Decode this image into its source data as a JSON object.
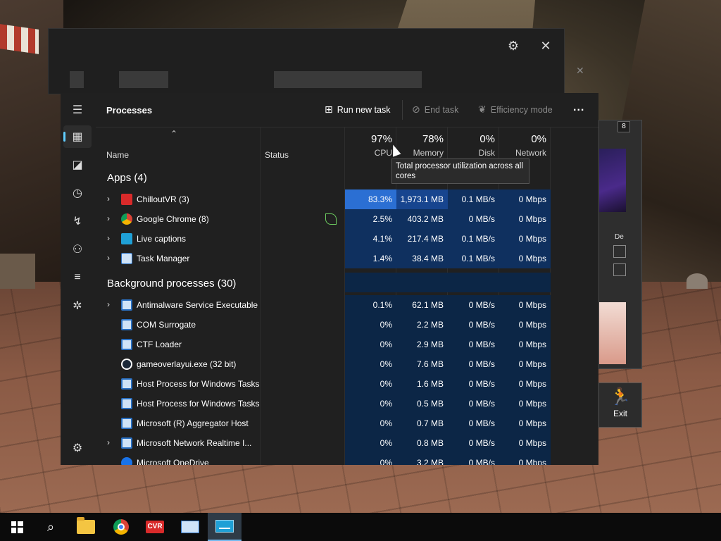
{
  "scene": {
    "exit_label": "Exit",
    "side_badge": "8",
    "side_text": "De"
  },
  "task_manager": {
    "page_title": "Processes",
    "commands": {
      "run_new_task": "Run new task",
      "end_task": "End task",
      "efficiency_mode": "Efficiency mode",
      "more": "..."
    },
    "columns": {
      "name": "Name",
      "status": "Status",
      "cpu": {
        "pct": "97%",
        "label": "CPU"
      },
      "memory": {
        "pct": "78%",
        "label": "Memory"
      },
      "disk": {
        "pct": "0%",
        "label": "Disk"
      },
      "network": {
        "pct": "0%",
        "label": "Network"
      }
    },
    "tooltip": "Total processor utilization across all cores",
    "apps_heading": "Apps (4)",
    "apps": [
      {
        "name": "ChilloutVR (3)",
        "cpu": "83.3%",
        "memory": "1,973.1 MB",
        "disk": "0.1 MB/s",
        "network": "0 Mbps",
        "icon": "chilloutvr-icon"
      },
      {
        "name": "Google Chrome (8)",
        "cpu": "2.5%",
        "memory": "403.2 MB",
        "disk": "0 MB/s",
        "network": "0 Mbps",
        "icon": "chrome-icon"
      },
      {
        "name": "Live captions",
        "cpu": "4.1%",
        "memory": "217.4 MB",
        "disk": "0.1 MB/s",
        "network": "0 Mbps",
        "icon": "live-captions-icon"
      },
      {
        "name": "Task Manager",
        "cpu": "1.4%",
        "memory": "38.4 MB",
        "disk": "0.1 MB/s",
        "network": "0 Mbps",
        "icon": "task-manager-icon"
      }
    ],
    "bg_heading": "Background processes (30)",
    "background": [
      {
        "name": "Antimalware Service Executable",
        "cpu": "0.1%",
        "memory": "62.1 MB",
        "disk": "0 MB/s",
        "network": "0 Mbps"
      },
      {
        "name": "COM Surrogate",
        "cpu": "0%",
        "memory": "2.2 MB",
        "disk": "0 MB/s",
        "network": "0 Mbps"
      },
      {
        "name": "CTF Loader",
        "cpu": "0%",
        "memory": "2.9 MB",
        "disk": "0 MB/s",
        "network": "0 Mbps"
      },
      {
        "name": "gameoverlayui.exe (32 bit)",
        "cpu": "0%",
        "memory": "7.6 MB",
        "disk": "0 MB/s",
        "network": "0 Mbps"
      },
      {
        "name": "Host Process for Windows Tasks",
        "cpu": "0%",
        "memory": "1.6 MB",
        "disk": "0 MB/s",
        "network": "0 Mbps"
      },
      {
        "name": "Host Process for Windows Tasks",
        "cpu": "0%",
        "memory": "0.5 MB",
        "disk": "0 MB/s",
        "network": "0 Mbps"
      },
      {
        "name": "Microsoft (R) Aggregator Host",
        "cpu": "0%",
        "memory": "0.7 MB",
        "disk": "0 MB/s",
        "network": "0 Mbps"
      },
      {
        "name": "Microsoft Network Realtime I...",
        "cpu": "0%",
        "memory": "0.8 MB",
        "disk": "0 MB/s",
        "network": "0 Mbps"
      },
      {
        "name": "Microsoft OneDrive",
        "cpu": "0%",
        "memory": "3.2 MB",
        "disk": "0 MB/s",
        "network": "0 Mbps"
      }
    ]
  },
  "colors": {
    "accent": "#60cdff",
    "heat_strong": "#2b6fd3",
    "heat_mid": "#17458f",
    "heat_low": "#0f305f"
  }
}
